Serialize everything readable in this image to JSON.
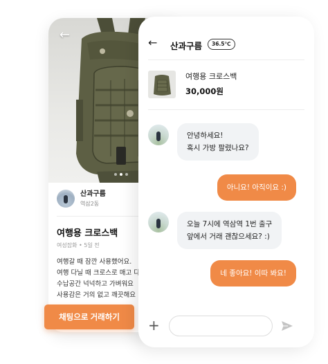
{
  "product_page": {
    "back_arrow": "←",
    "seller": {
      "name": "산과구름",
      "location": "역삼2동"
    },
    "title": "여행용 크로스백",
    "meta": "여성잡화 • 5일 전",
    "description": [
      "여행갈 때 잠깐 사용했어요.",
      "여행 다닐 때 크로스로 매고 다",
      "수납공간 넉넉하고 가벼워요",
      "사용감은 거의 없고 깨끗해요"
    ],
    "cta_label": "채팅으로 거래하기",
    "image_dots": 3,
    "active_dot": 1
  },
  "chat": {
    "back_arrow": "←",
    "partner_name": "산과구름",
    "manner_temp": "36.5℃",
    "product": {
      "name": "여행용 크로스백",
      "price": "30,000원"
    },
    "messages": [
      {
        "from": "them",
        "lines": [
          "안녕하세요!",
          "혹시 가방 팔렸나요?"
        ]
      },
      {
        "from": "me",
        "text": "아니요! 아직이요 :)"
      },
      {
        "from": "them",
        "lines": [
          "오늘 7시에 역삼역 1번 출구",
          "앞에서 거래 괜찮으세요? :)"
        ]
      },
      {
        "from": "me",
        "text": "네 좋아요! 이따 봐요!"
      }
    ],
    "composer": {
      "plus": "+",
      "placeholder": ""
    }
  },
  "colors": {
    "accent": "#f08a47",
    "bubble_in": "#f1f3f5",
    "bag": "#5d5f44"
  }
}
